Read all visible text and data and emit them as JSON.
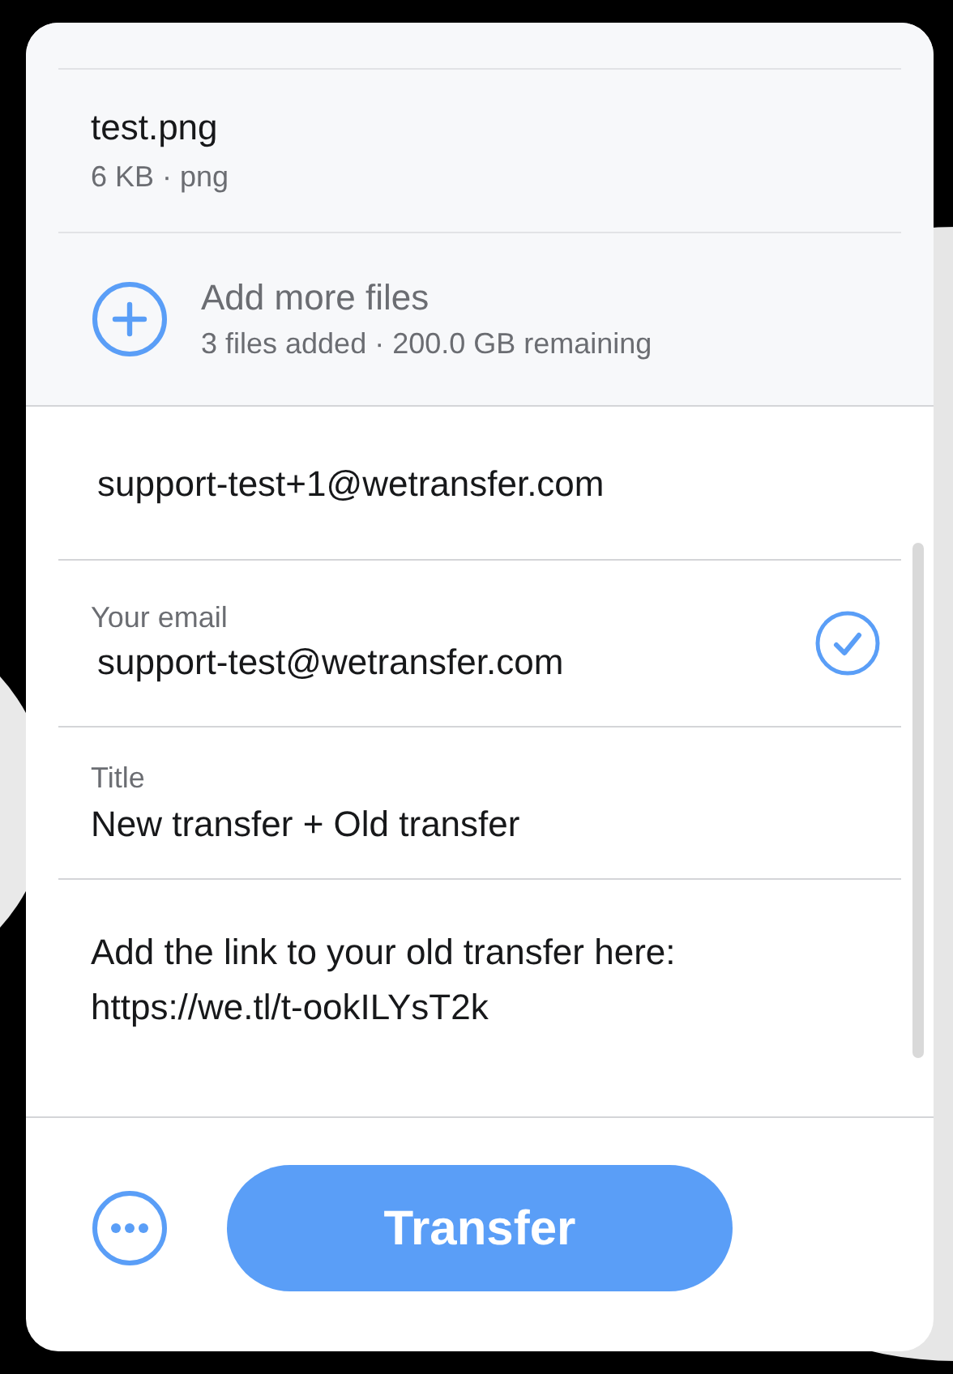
{
  "files": [
    {
      "name": "test.png",
      "meta": "6 KB · png"
    }
  ],
  "add_files": {
    "label": "Add more files",
    "summary": "3 files added · 200.0 GB remaining"
  },
  "recipient": {
    "value": "support-test+1@wetransfer.com"
  },
  "sender": {
    "label": "Your email",
    "value": "support-test@wetransfer.com",
    "verified": true
  },
  "title": {
    "label": "Title",
    "value": "New transfer + Old transfer"
  },
  "message": {
    "value": "Add the link to your old transfer here: https://we.tl/t-ookILYsT2k"
  },
  "transfer_button": {
    "label": "Transfer"
  }
}
